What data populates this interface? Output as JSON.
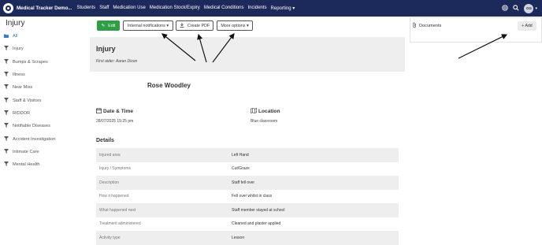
{
  "topbar": {
    "brand": "Medical Tracker Demo...",
    "nav": [
      "Students",
      "Staff",
      "Medication Use",
      "Medication Stock/Expiry",
      "Medical Conditions",
      "Incidents",
      "Reporting ▾"
    ],
    "avatar_initials": "GG",
    "icons": [
      "help-icon",
      "search-icon",
      "avatar"
    ]
  },
  "page": {
    "title": "Injury"
  },
  "sidebar": {
    "items": [
      {
        "label": "All",
        "active": true,
        "icon": "folder-icon"
      },
      {
        "label": "Injury",
        "icon": "filter-icon"
      },
      {
        "label": "Bumps & Scrapes",
        "icon": "filter-icon"
      },
      {
        "label": "Illness",
        "icon": "filter-icon"
      },
      {
        "label": "Near Miss",
        "icon": "filter-icon"
      },
      {
        "label": "Staff & Visitors",
        "icon": "filter-icon"
      },
      {
        "label": "RIDDOR",
        "icon": "filter-icon"
      },
      {
        "label": "Notifiable Diseases",
        "icon": "filter-icon"
      },
      {
        "label": "Accident Investigation",
        "icon": "filter-icon"
      },
      {
        "label": "Intimate Care",
        "icon": "filter-icon"
      },
      {
        "label": "Mental Health",
        "icon": "filter-icon"
      }
    ]
  },
  "toolbar": {
    "edit_label": "Edit",
    "notifications_label": "Internal notifications ▾",
    "pdf_label": "Create PDF",
    "more_label": "More options ▾"
  },
  "record": {
    "title": "Injury",
    "first_aider": "First aider: Aaran Dixon",
    "person": "Rose Woodley",
    "datetime_label": "Date & Time",
    "datetime_value": "28/07/2025 15:25 pm",
    "location_label": "Location",
    "location_value": "Blue classroom",
    "details_label": "Details",
    "details": [
      {
        "key": "Injured area",
        "value": "Left Hand"
      },
      {
        "key": "Injury / Symptoms",
        "value": "Cut/Graze"
      },
      {
        "key": "Description",
        "value": "Staff fell over"
      },
      {
        "key": "How it happened",
        "value": "Fell over whilst in class"
      },
      {
        "key": "What happened next",
        "value": "Staff member stayed at school"
      },
      {
        "key": "Treatment administered",
        "value": "Cleaned and plaster applied"
      },
      {
        "key": "Activity type",
        "value": "Lesson"
      }
    ]
  },
  "documents": {
    "title": "Documents",
    "add_label": "+ Add"
  },
  "colors": {
    "nav_bg": "#1b2a5a",
    "edit_green": "#2e9e44",
    "active_blue": "#2a7ae2"
  }
}
